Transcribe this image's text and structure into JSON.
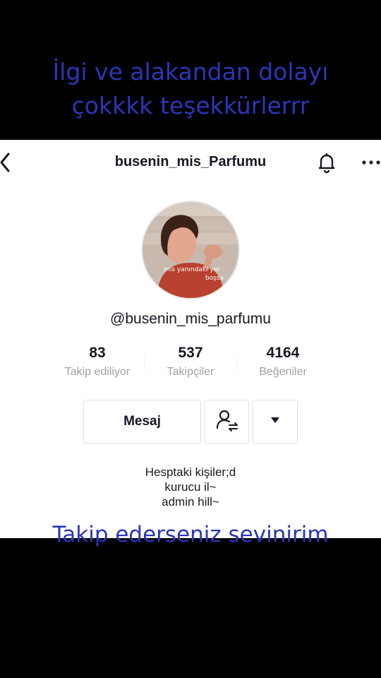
{
  "overlay": {
    "top_line1": "İlgi ve alakandan dolayı",
    "top_line2": "çokkkk teşekkürlerrr",
    "bottom": "Takip ederseniz sevinirim"
  },
  "header": {
    "title": "busenin_mis_Parfumu",
    "icons": [
      "back-icon",
      "bell-icon",
      "more-icon"
    ]
  },
  "profile": {
    "handle": "@busenin_mis_parfumu",
    "avatar_caption_line1": "mis yanındaki yer",
    "avatar_caption_line2": "boşsa"
  },
  "stats": [
    {
      "value": "83",
      "label": "Takip ediliyor"
    },
    {
      "value": "537",
      "label": "Takipçiler"
    },
    {
      "value": "4164",
      "label": "Beğeniler"
    }
  ],
  "actions": {
    "message_label": "Mesaj",
    "follow_icon": "user-swap-icon",
    "dropdown_icon": "caret-down-icon"
  },
  "bio": [
    "Hesptaki kişiler;d",
    "kurucu il~",
    "admin hill~"
  ],
  "colors": {
    "overlay_text": "#2b36b8",
    "panel_bg": "#ffffff",
    "text_primary": "#161823",
    "text_secondary": "#a0a1a7"
  }
}
